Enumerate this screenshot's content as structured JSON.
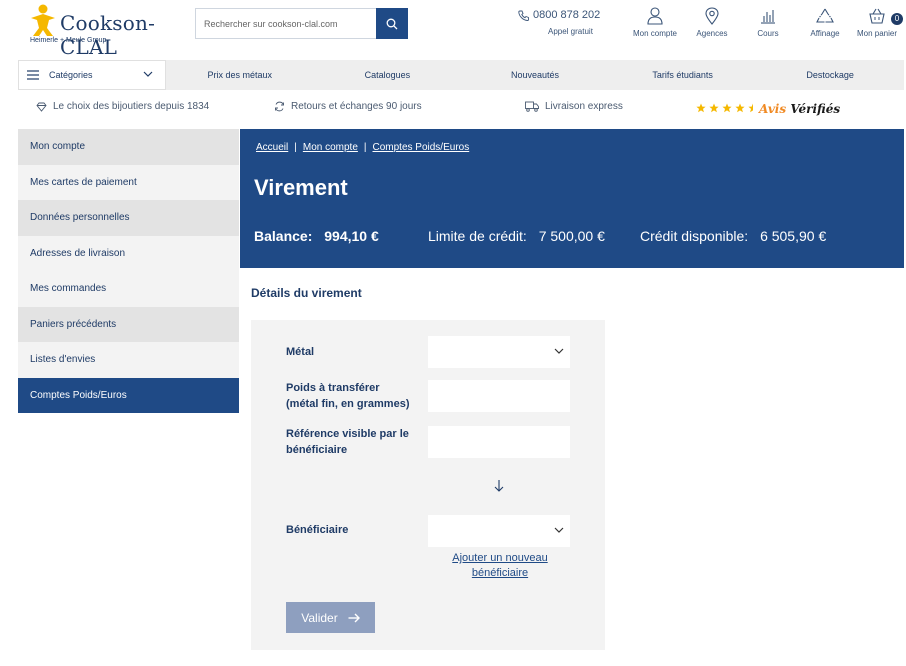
{
  "header": {
    "logo_text": "Cookson-CLAL",
    "logo_sub": "Heimerle + Meule Group",
    "search_placeholder": "Rechercher sur cookson-clal.com",
    "phone": "0800 878 202",
    "phone_sub": "Appel gratuit",
    "icons": [
      {
        "label": "Mon compte",
        "icon": "user-icon"
      },
      {
        "label": "Agences",
        "icon": "location-pin-icon"
      },
      {
        "label": "Cours",
        "icon": "bar-chart-icon"
      },
      {
        "label": "Affinage",
        "icon": "recycle-icon"
      },
      {
        "label": "Mon panier",
        "icon": "basket-icon"
      }
    ],
    "cart_count": "0"
  },
  "nav": {
    "categories": "Catégories",
    "items": [
      "Prix des métaux",
      "Catalogues",
      "Nouveautés",
      "Tarifs étudiants",
      "Destockage"
    ]
  },
  "trust": {
    "items": [
      {
        "label": "Le choix des bijoutiers depuis 1834",
        "icon": "diamond-icon"
      },
      {
        "label": "Retours et échanges 90 jours",
        "icon": "refresh-icon"
      },
      {
        "label": "Livraison express",
        "icon": "truck-icon"
      }
    ],
    "rating_stars": 4.5,
    "avis_word1": "Avis",
    "avis_word2": "Vérifiés"
  },
  "sidebar": {
    "items": [
      {
        "label": "Mon compte"
      },
      {
        "label": "Mes cartes de paiement"
      },
      {
        "label": "Données personnelles"
      },
      {
        "label": "Adresses de livraison"
      },
      {
        "label": "Mes commandes"
      },
      {
        "label": "Paniers précédents"
      },
      {
        "label": "Listes d'envies"
      },
      {
        "label": "Comptes Poids/Euros"
      }
    ],
    "active_index": 7
  },
  "banner": {
    "breadcrumb": [
      "Accueil",
      "Mon compte",
      "Comptes Poids/Euros"
    ],
    "title": "Virement",
    "balance_label": "Balance:",
    "balance_value": "994,10 €",
    "credit_limit_label": "Limite de crédit:",
    "credit_limit_value": "7 500,00 €",
    "available_label": "Crédit disponible:",
    "available_value": "6 505,90 €"
  },
  "form": {
    "section_title": "Détails du virement",
    "metal_label": "Métal",
    "metal_value": "",
    "weight_label_1": "Poids à transférer",
    "weight_label_2": "(métal fin, en grammes)",
    "weight_value": "",
    "reference_label_1": "Référence visible par le",
    "reference_label_2": "bénéficiaire",
    "reference_value": "",
    "beneficiary_label": "Bénéficiaire",
    "beneficiary_value": "",
    "add_beneficiary_1": "Ajouter un nouveau",
    "add_beneficiary_2": "bénéficiaire",
    "submit_label": "Valider"
  },
  "colors": {
    "primary": "#1f4a86",
    "text": "#1f3b66",
    "submit_disabled": "#8e9fbf",
    "star": "#f5b800",
    "avis_orange": "#f08a24"
  }
}
